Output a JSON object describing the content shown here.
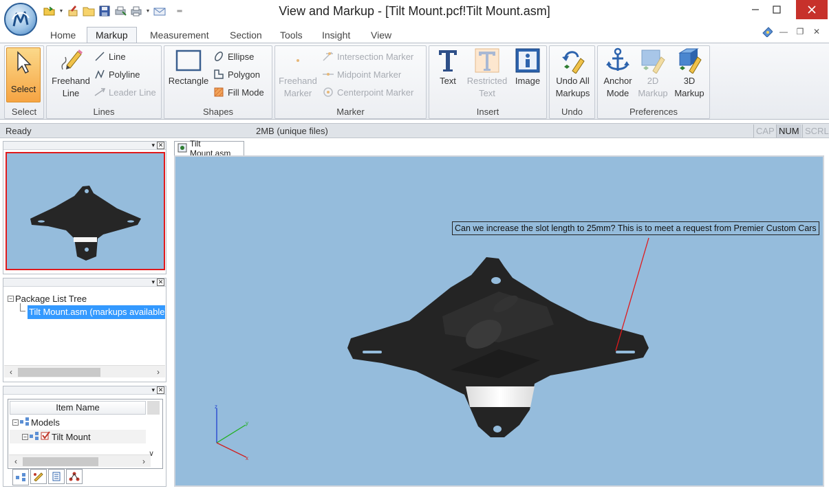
{
  "window": {
    "title": "View and Markup - [Tilt Mount.pcf!Tilt Mount.asm]",
    "controls": {
      "minimize": "—",
      "maximize": "□",
      "close": "✕"
    }
  },
  "quick_access": [
    "open-icon",
    "brush-icon",
    "folder-icon",
    "save-icon",
    "printer-setup-icon",
    "print-icon",
    "email-icon",
    "customize-icon"
  ],
  "tabs": [
    "Home",
    "Markup",
    "Measurement",
    "Section",
    "Tools",
    "Insight",
    "View"
  ],
  "active_tab": "Markup",
  "mdi_controls": [
    "help-icon",
    "—",
    "❐",
    "✕"
  ],
  "ribbon": {
    "select": {
      "button": "Select",
      "group": "Select"
    },
    "lines": {
      "freehand": [
        "Freehand",
        "Line"
      ],
      "line": "Line",
      "polyline": "Polyline",
      "leader": "Leader Line",
      "group": "Lines"
    },
    "shapes": {
      "rectangle": "Rectangle",
      "ellipse": "Ellipse",
      "polygon": "Polygon",
      "fill": "Fill Mode",
      "group": "Shapes"
    },
    "marker": {
      "freehand": [
        "Freehand",
        "Marker"
      ],
      "intersection": "Intersection Marker",
      "midpoint": "Midpoint Marker",
      "centerpoint": "Centerpoint Marker",
      "group": "Marker"
    },
    "insert": {
      "text": "Text",
      "restricted": [
        "Restricted",
        "Text"
      ],
      "image": "Image",
      "group": "Insert"
    },
    "undo": {
      "button": [
        "Undo All",
        "Markups"
      ],
      "group": "Undo"
    },
    "preferences": {
      "anchor": [
        "Anchor",
        "Mode"
      ],
      "markup2d": [
        "2D",
        "Markup"
      ],
      "markup3d": [
        "3D",
        "Markup"
      ],
      "group": "Preferences"
    }
  },
  "status": {
    "ready": "Ready",
    "files": "2MB (unique files)",
    "indicators": [
      "CAP",
      "NUM",
      "SCRL"
    ],
    "indicator_active": [
      false,
      true,
      false
    ]
  },
  "package_tree": {
    "root": "Package List Tree",
    "item": "Tilt Mount.asm (markups available)"
  },
  "item_table": {
    "header": "Item Name",
    "rows": [
      "Models",
      "Tilt Mount"
    ]
  },
  "document_tab": "Tilt Mount.asm",
  "markup_text": "Can we increase the slot length to 25mm? This is to meet a request from Premier Custom Cars",
  "axes": [
    "z",
    "y",
    "x"
  ],
  "colors": {
    "viewport_bg": "#95bcdc",
    "select_active": "#f6a443",
    "selection_highlight": "#3399ff",
    "thumb_border": "#e0191c",
    "leader_line": "#e0191c"
  }
}
